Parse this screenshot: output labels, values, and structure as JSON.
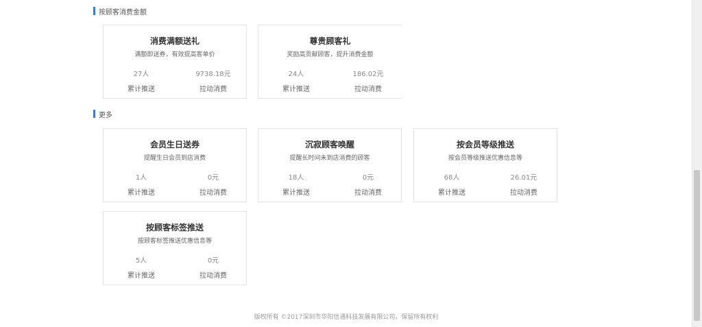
{
  "sections": [
    {
      "title": "按顾客消费金额",
      "cards": [
        {
          "title": "消费满额送礼",
          "desc": "满额即送券，有效提高客单价",
          "count": "27人",
          "amount": "9738.18元",
          "count_label": "累计推送",
          "amount_label": "拉动消费"
        },
        {
          "title": "尊贵顾客礼",
          "desc": "奖励高贡献顾客，提升消费金额",
          "count": "24人",
          "amount": "186.02元",
          "count_label": "累计推送",
          "amount_label": "拉动消费"
        }
      ]
    },
    {
      "title": "更多",
      "cards": [
        {
          "title": "会员生日送券",
          "desc": "提醒生日会员到店消费",
          "count": "1人",
          "amount": "0元",
          "count_label": "累计推送",
          "amount_label": "拉动消费"
        },
        {
          "title": "沉寂顾客唤醒",
          "desc": "提醒长时间未到店消费的顾客",
          "count": "18人",
          "amount": "0元",
          "count_label": "累计推送",
          "amount_label": "拉动消费"
        },
        {
          "title": "按会员等级推送",
          "desc": "按会员等级推送优惠信息等",
          "count": "68人",
          "amount": "26.01元",
          "count_label": "累计推送",
          "amount_label": "拉动消费"
        },
        {
          "title": "按顾客标签推送",
          "desc": "按顾客标签推送优惠信息等",
          "count": "5人",
          "amount": "0元",
          "count_label": "累计推送",
          "amount_label": "拉动消费"
        }
      ]
    }
  ],
  "footer": "版权所有 ©2017深圳市华阳信通科技发展有限公司，保留所有权利",
  "colors": {
    "accent": "#3a7bd5",
    "border": "#e2e2e2"
  }
}
